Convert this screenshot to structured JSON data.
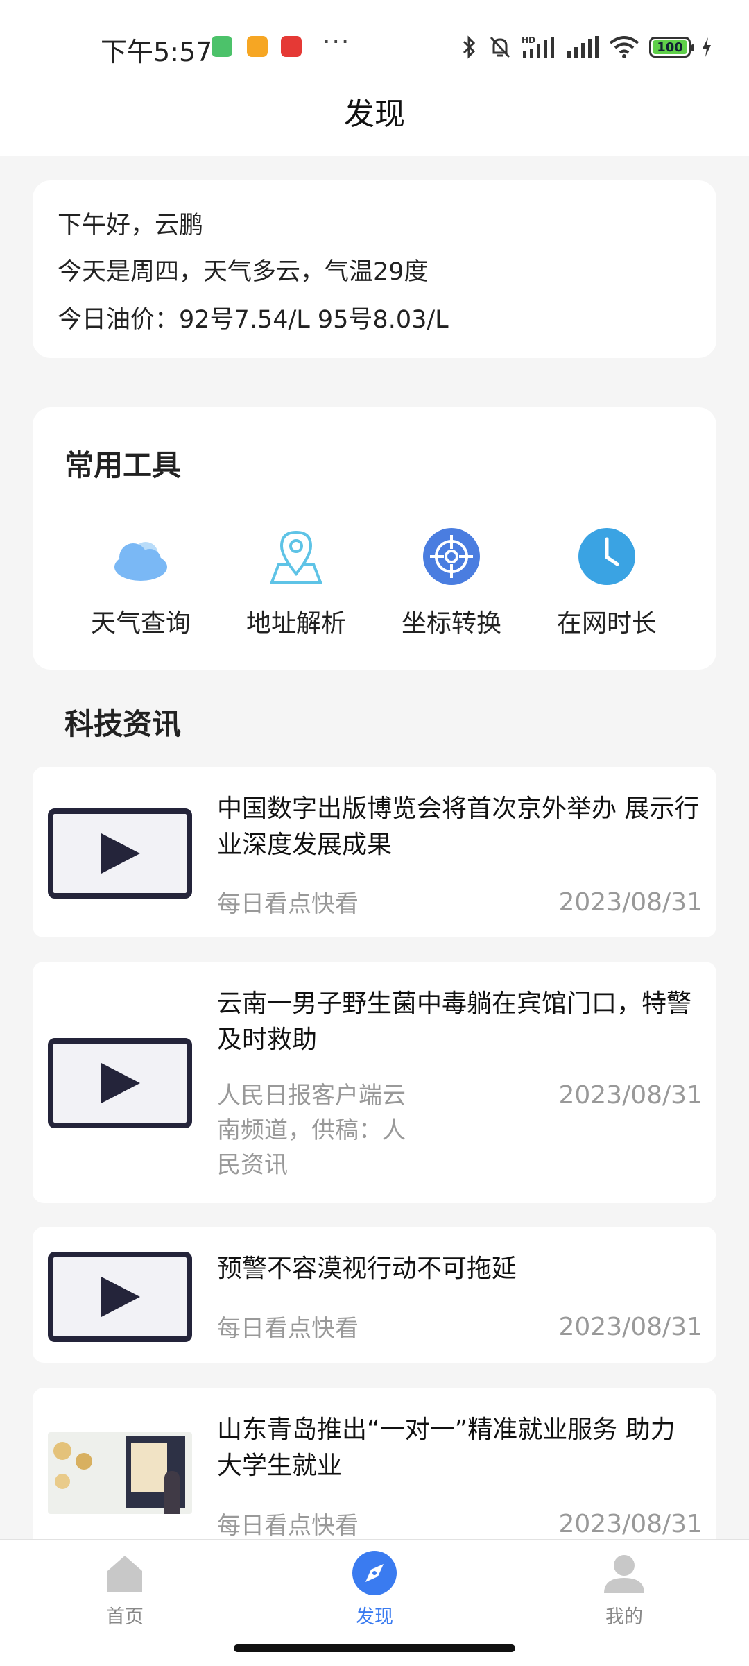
{
  "status_bar": {
    "time": "下午5:57",
    "icons": [
      "wechat-app-icon",
      "files-app-icon",
      "kankan-app-icon",
      "more-dots",
      "bluetooth-icon",
      "mute-bell-icon",
      "hd-signal-icon",
      "signal-icon",
      "wifi-icon",
      "battery-icon",
      "charging-icon"
    ],
    "more": "···",
    "battery": "100",
    "colors": {
      "battery_fill": "#5fd04a",
      "app1": "#4cc26a",
      "app2": "#f6a623",
      "app3": "#e53935"
    }
  },
  "header": {
    "title": "发现"
  },
  "greeting": {
    "line1": "下午好，云鹏",
    "line2": "今天是周四，天气多云，气温29度",
    "line3": "今日油价：92号7.54/L  95号8.03/L"
  },
  "tools": {
    "title": "常用工具",
    "items": [
      {
        "label": "天气查询",
        "icon": "cloud-icon",
        "color": "#7ab8f5"
      },
      {
        "label": "地址解析",
        "icon": "location-pin-icon",
        "color": "#5ec3e6"
      },
      {
        "label": "坐标转换",
        "icon": "crosshair-target-icon",
        "color": "#4a7de0"
      },
      {
        "label": "在网时长",
        "icon": "clock-icon",
        "color": "#3aa3e3"
      }
    ]
  },
  "news": {
    "title": "科技资讯",
    "items": [
      {
        "title": "中国数字出版博览会将首次京外举办 展示行业深度发展成果",
        "source": "每日看点快看",
        "date": "2023/08/31",
        "thumb": "play-icon"
      },
      {
        "title": "云南一男子野生菌中毒躺在宾馆门口，特警及时救助",
        "source": "人民日报客户端云南频道，供稿：人民资讯",
        "date": "2023/08/31",
        "thumb": "play-icon"
      },
      {
        "title": "预警不容漠视行动不可拖延",
        "source": "每日看点快看",
        "date": "2023/08/31",
        "thumb": "play-icon"
      },
      {
        "title": "山东青岛推出“一对一”精准就业服务 助力大学生就业",
        "source": "每日看点快看",
        "date": "2023/08/31",
        "thumb": "photo-thumbnail"
      }
    ]
  },
  "tabbar": {
    "tabs": [
      {
        "label": "首页",
        "icon": "home-icon",
        "active": false
      },
      {
        "label": "发现",
        "icon": "compass-icon",
        "active": true
      },
      {
        "label": "我的",
        "icon": "profile-icon",
        "active": false
      }
    ],
    "colors": {
      "active": "#3a7bf0",
      "inactive": "#c8c8c8"
    }
  }
}
